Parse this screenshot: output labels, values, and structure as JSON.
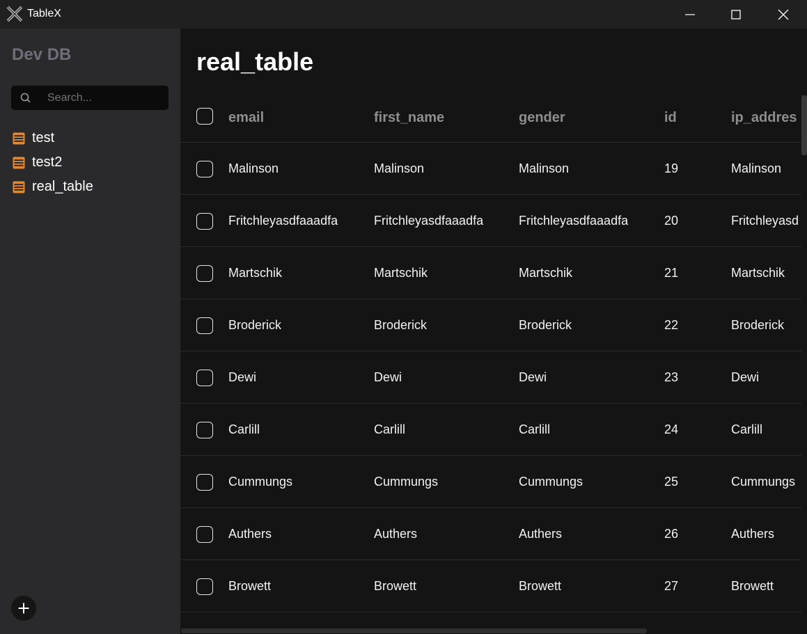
{
  "window": {
    "title": "TableX"
  },
  "sidebar": {
    "db_name": "Dev DB",
    "search": {
      "placeholder": "Search...",
      "value": ""
    },
    "tables": [
      {
        "label": "test"
      },
      {
        "label": "test2"
      },
      {
        "label": "real_table"
      }
    ]
  },
  "main": {
    "title": "real_table",
    "columns": [
      "email",
      "first_name",
      "gender",
      "id",
      "ip_addres"
    ],
    "rows": [
      {
        "email": "Malinson",
        "first_name": "Malinson",
        "gender": "Malinson",
        "id": "19",
        "ip_address": "Malinson"
      },
      {
        "email": "Fritchleyasdfaaadfa",
        "first_name": "Fritchleyasdfaaadfa",
        "gender": "Fritchleyasdfaaadfa",
        "id": "20",
        "ip_address": "Fritchleyasd"
      },
      {
        "email": "Martschik",
        "first_name": "Martschik",
        "gender": "Martschik",
        "id": "21",
        "ip_address": "Martschik"
      },
      {
        "email": "Broderick",
        "first_name": "Broderick",
        "gender": "Broderick",
        "id": "22",
        "ip_address": "Broderick"
      },
      {
        "email": "Dewi",
        "first_name": "Dewi",
        "gender": "Dewi",
        "id": "23",
        "ip_address": "Dewi"
      },
      {
        "email": "Carlill",
        "first_name": "Carlill",
        "gender": "Carlill",
        "id": "24",
        "ip_address": "Carlill"
      },
      {
        "email": "Cummungs",
        "first_name": "Cummungs",
        "gender": "Cummungs",
        "id": "25",
        "ip_address": "Cummungs"
      },
      {
        "email": "Authers",
        "first_name": "Authers",
        "gender": "Authers",
        "id": "26",
        "ip_address": "Authers"
      },
      {
        "email": "Browett",
        "first_name": "Browett",
        "gender": "Browett",
        "id": "27",
        "ip_address": "Browett"
      }
    ]
  },
  "colors": {
    "accent_table_icon": "#e8862c",
    "sidebar_bg": "#2a2a2c",
    "main_bg": "#141414",
    "titlebar_bg": "#202020",
    "muted_text": "#8e8e8e"
  },
  "icons": {
    "app": "tablex-logo-icon",
    "search": "search-icon",
    "table": "table-icon",
    "add": "plus-icon",
    "minimize": "minimize-icon",
    "maximize": "maximize-icon",
    "close": "close-icon"
  }
}
